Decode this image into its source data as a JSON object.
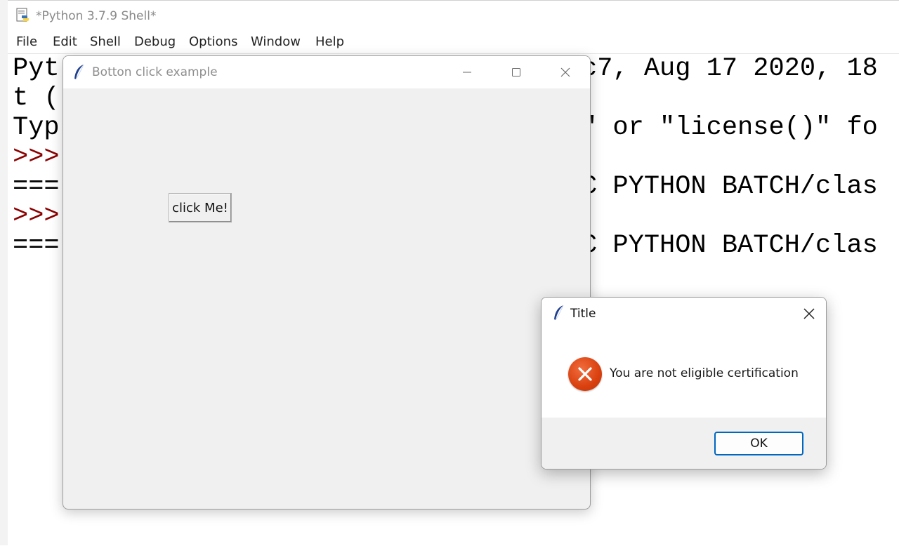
{
  "shell": {
    "title": "*Python 3.7.9 Shell*",
    "menu": [
      "File",
      "Edit",
      "Shell",
      "Debug",
      "Options",
      "Window",
      "Help"
    ],
    "lines": [
      {
        "prefix": "",
        "text": "Pyt"
      },
      {
        "prefix": "",
        "text": "t ("
      },
      {
        "prefix": "",
        "text": "Typ"
      },
      {
        "prefix": ">>>",
        "text": ""
      },
      {
        "prefix": "",
        "text": "==="
      },
      {
        "prefix": ">>>",
        "text": ""
      },
      {
        "prefix": "",
        "text": "==="
      }
    ],
    "right_lines": [
      "c7, Aug 17 2020, 18",
      "\" or \"license()\" fo",
      "C PYTHON BATCH/clas",
      "C PYTHON BATCH/clas"
    ]
  },
  "tk_window": {
    "title": "Botton click example",
    "button_label": "click Me!",
    "icons": {
      "app": "feather-icon",
      "minimize": "minimize-icon",
      "maximize": "maximize-icon",
      "close": "close-icon"
    }
  },
  "msgbox": {
    "title": "Title",
    "message": "You are not eligible certification",
    "ok_label": "OK",
    "icons": {
      "app": "feather-icon",
      "error": "error-icon",
      "close": "close-icon"
    },
    "colors": {
      "error": "#d9400f",
      "ok_border": "#0067c0"
    }
  }
}
